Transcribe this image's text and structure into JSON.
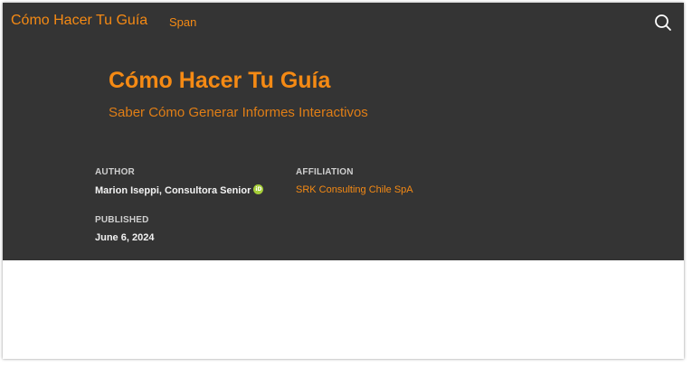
{
  "navbar": {
    "brand": "Cómo Hacer Tu Guía",
    "link": "Span",
    "search_icon": "search-icon"
  },
  "header": {
    "title": "Cómo Hacer Tu Guía",
    "subtitle": "Saber Cómo Generar Informes Interactivos"
  },
  "meta": {
    "author_label": "AUTHOR",
    "author_name": "Marion Iseppi, Consultora Senior",
    "orcid_icon": "orcid-icon",
    "orcid_text": "iD",
    "affiliation_label": "AFFILIATION",
    "affiliation_name": "SRK Consulting Chile SpA",
    "published_label": "PUBLISHED",
    "published_date": "June 6, 2024"
  },
  "colors": {
    "banner_bg": "#343434",
    "accent": "#f58a14",
    "orcid_green": "#a6ce39"
  }
}
